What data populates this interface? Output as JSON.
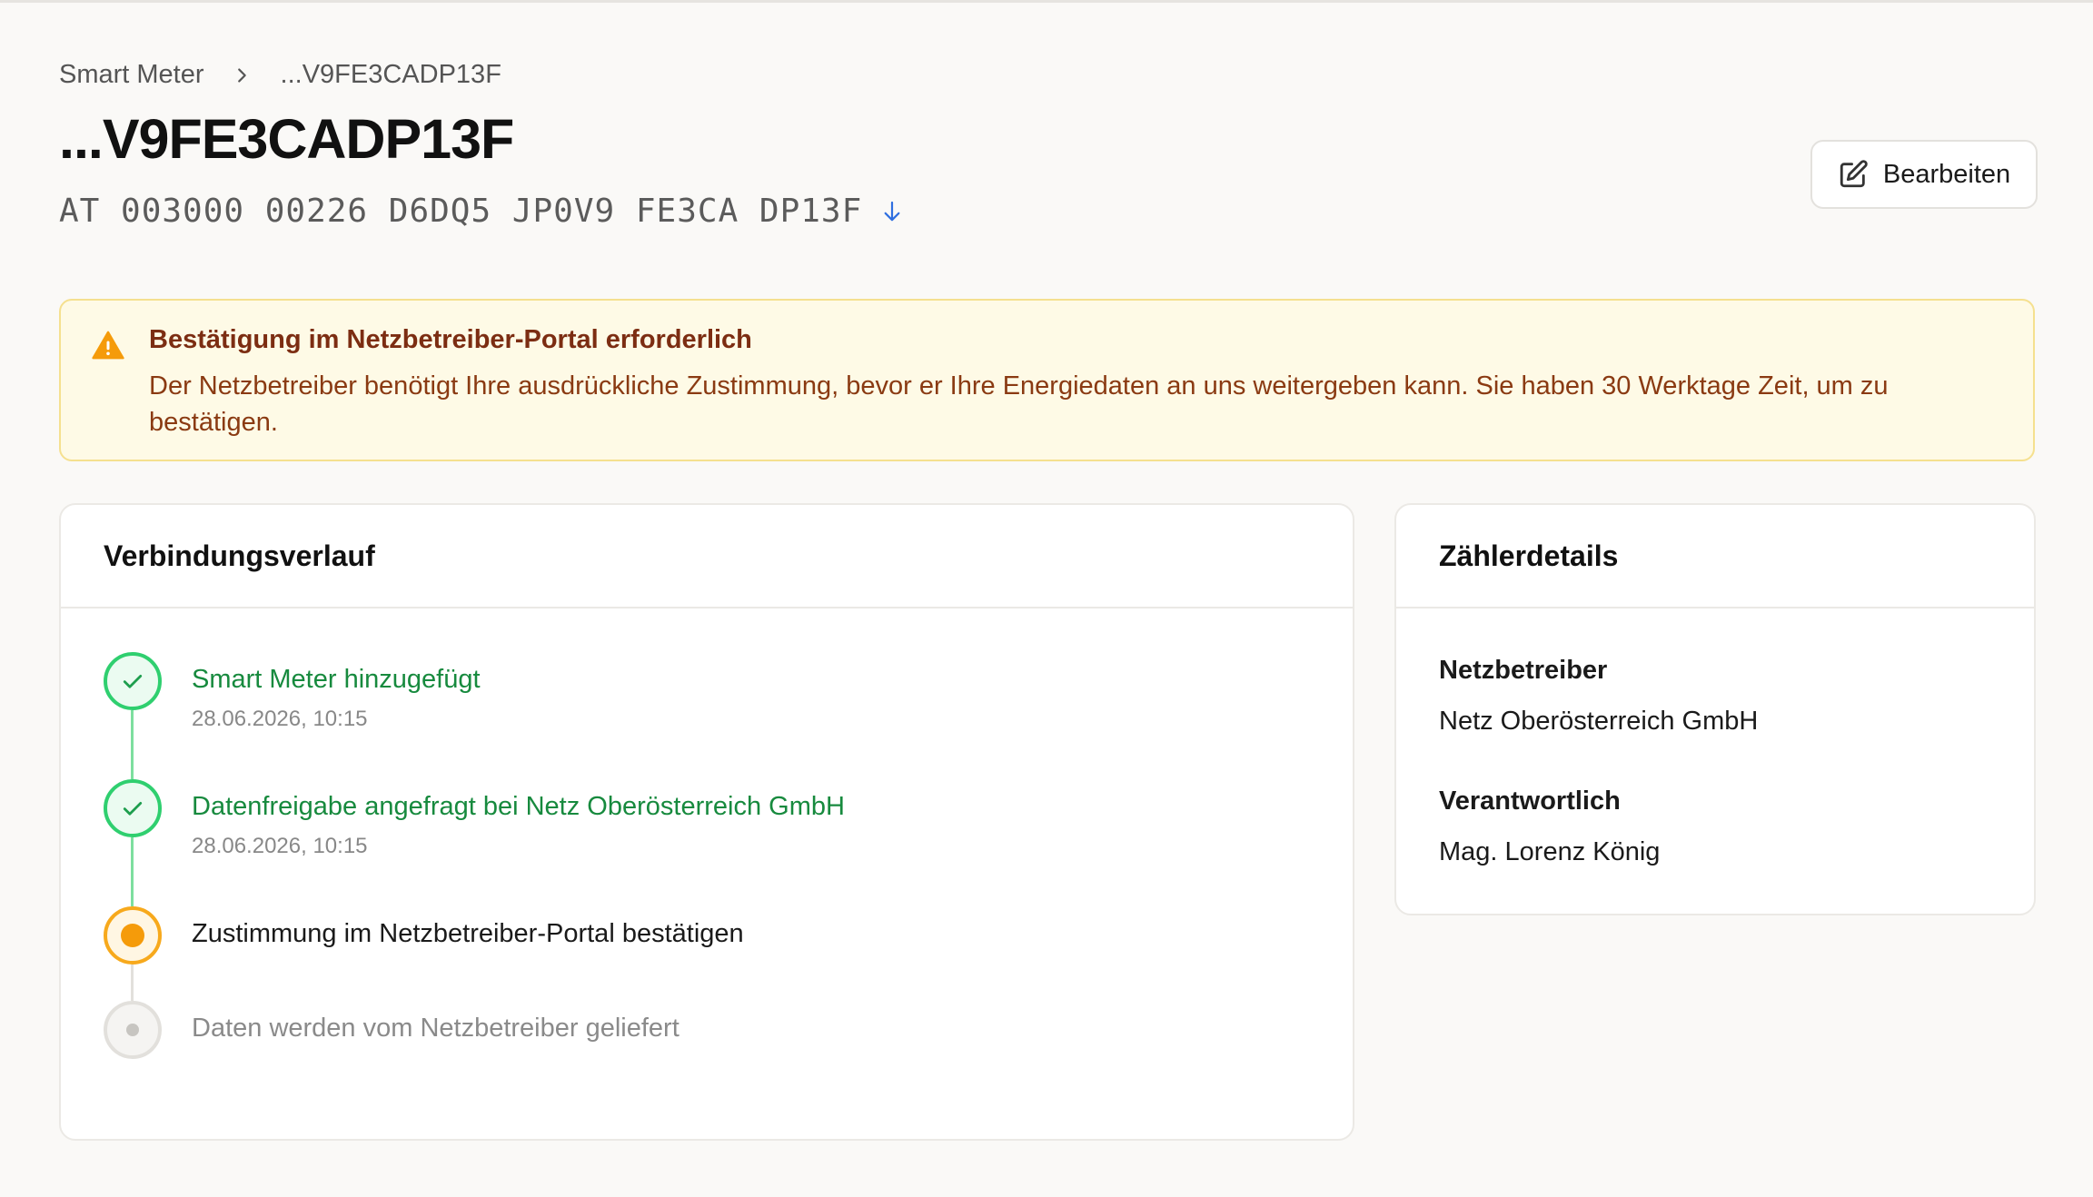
{
  "breadcrumb": {
    "root": "Smart Meter",
    "current": "...V9FE3CADP13F"
  },
  "header": {
    "title": "...V9FE3CADP13F",
    "meter_point_id": "AT 003000 00226 D6DQ5 JP0V9 FE3CA DP13F",
    "edit_label": "Bearbeiten"
  },
  "warning": {
    "title": "Bestätigung im Netzbetreiber-Portal erforderlich",
    "text": "Der Netzbetreiber benötigt Ihre ausdrückliche Zustimmung, bevor er Ihre Energiedaten an uns weitergeben kann. Sie haben 30 Werktage Zeit, um zu bestätigen."
  },
  "timeline": {
    "heading": "Verbindungsverlauf",
    "steps": [
      {
        "label": "Smart Meter hinzugefügt",
        "date": "28.06.2026, 10:15",
        "status": "done"
      },
      {
        "label": "Datenfreigabe angefragt bei Netz Oberösterreich GmbH",
        "date": "28.06.2026, 10:15",
        "status": "done"
      },
      {
        "label": "Zustimmung im Netzbetreiber-Portal bestätigen",
        "status": "active"
      },
      {
        "label": "Daten werden vom Netzbetreiber geliefert",
        "status": "pending"
      }
    ]
  },
  "details": {
    "heading": "Zählerdetails",
    "grid_operator_label": "Netzbetreiber",
    "grid_operator_value": "Netz Oberösterreich GmbH",
    "responsible_label": "Verantwortlich",
    "responsible_value": "Mag. Lorenz König"
  },
  "colors": {
    "done": "#2fcf6f",
    "active": "#f59b0a",
    "pending": "#c7c5c1",
    "warning_bg": "#fefae6",
    "warning_text": "#8a3a12",
    "link": "#2f6fe0"
  }
}
